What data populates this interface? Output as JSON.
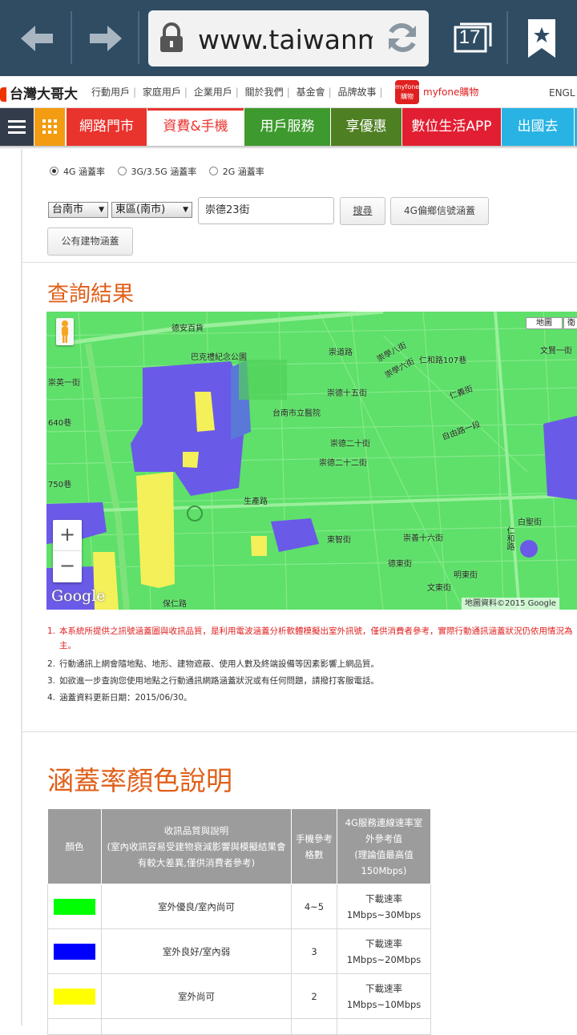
{
  "browser": {
    "url": "www.taiwanmobile.com",
    "tab_count": "17",
    "colors": {
      "chrome": "#2f4c63"
    },
    "icons": [
      "back-arrow-icon",
      "forward-arrow-icon",
      "lock-icon",
      "refresh-icon",
      "tabs-icon",
      "bookmark-icon"
    ]
  },
  "site": {
    "logo": "台灣大哥大",
    "top_links": [
      "行動用戶",
      "家庭用戶",
      "企業用戶",
      "關於我們",
      "基金會",
      "品牌故事"
    ],
    "myfone_badge": "myfone購物",
    "myfone_label": "myfone購物",
    "lang": "ENGL"
  },
  "nav": {
    "items": [
      {
        "label": "網路門市",
        "color": "#e9332d"
      },
      {
        "label": "資費&手機",
        "color": "#ffffff",
        "text_color": "#e9332d",
        "active": true
      },
      {
        "label": "用戶服務",
        "color": "#3e9a2e"
      },
      {
        "label": "享優惠",
        "color": "#4f7f23"
      },
      {
        "label": "數位生活APP",
        "color": "#e21e32"
      },
      {
        "label": "出國去",
        "color": "#28b3e4"
      }
    ]
  },
  "coverage_options": [
    {
      "label": "4G 涵蓋率",
      "selected": true
    },
    {
      "label": "3G/3.5G 涵蓋率",
      "selected": false
    },
    {
      "label": "2G 涵蓋率",
      "selected": false
    }
  ],
  "query": {
    "city": "台南市",
    "district": "東區(南市)",
    "street": "崇德23街",
    "search_button": "搜尋",
    "rural_button": "4G偏鄉信號涵蓋",
    "public_button": "公有建物涵蓋"
  },
  "result_title": "查詢結果",
  "map": {
    "type_buttons": [
      "地圖",
      "衛"
    ],
    "credit": "地圖資料©2015 Google",
    "google": "Google",
    "zoom_in": "+",
    "zoom_out": "−",
    "colors": {
      "good": "#5ee06a",
      "fair": "#6a5ae8",
      "weak": "#f4f05a"
    },
    "labels": [
      "德安百貨",
      "巴克禮紀念公園",
      "崇道路",
      "崇學八街",
      "崇學六街",
      "仁和路107巷",
      "崇德十五街",
      "台南市立醫院",
      "崇德二十街",
      "崇德二十二街",
      "自由路一段",
      "仁義街",
      "生產路",
      "東智街",
      "崇善十六街",
      "德東街",
      "明東街",
      "文東街",
      "保仁路",
      "白聖街",
      "750巷",
      "640巷",
      "崇英一街",
      "文賢一街",
      "仁和路"
    ]
  },
  "notes": [
    "本系統所提供之訊號涵蓋圖與收訊品質，是利用電波涵蓋分析軟體模擬出室外訊號，僅供消費者參考，實際行動通訊涵蓋狀況仍依用情況為主。",
    "行動通訊上網會隨地點、地形、建物遮蔽、使用人數及終端設備等因素影響上網品質。",
    "如欲進一步查詢您使用地點之行動通訊網路涵蓋狀況或有任何問題，請撥打客服電話。",
    "涵蓋資料更新日期：2015/06/30。"
  ],
  "color_title": "涵蓋率顏色說明",
  "legend": {
    "headers": [
      "顏色",
      "收訊品質與說明\n(室內收訊容易受建物衰減影響與模擬結果會有較大差異,僅供消費者參考)",
      "手機參考格數",
      "4G服務連線速率室外參考值\n(理論值最高值150Mbps)"
    ],
    "rows": [
      {
        "color": "#00ff00",
        "quality": "室外優良/室內尚可",
        "bars": "4~5",
        "speed_1": "下載速率",
        "speed_2": "1Mbps~30Mbps"
      },
      {
        "color": "#0000ff",
        "quality": "室外良好/室內弱",
        "bars": "3",
        "speed_1": "下載速率",
        "speed_2": "1Mbps~20Mbps"
      },
      {
        "color": "#ffff00",
        "quality": "室外尚可",
        "bars": "2",
        "speed_1": "下載速率",
        "speed_2": "1Mbps~10Mbps"
      }
    ]
  }
}
